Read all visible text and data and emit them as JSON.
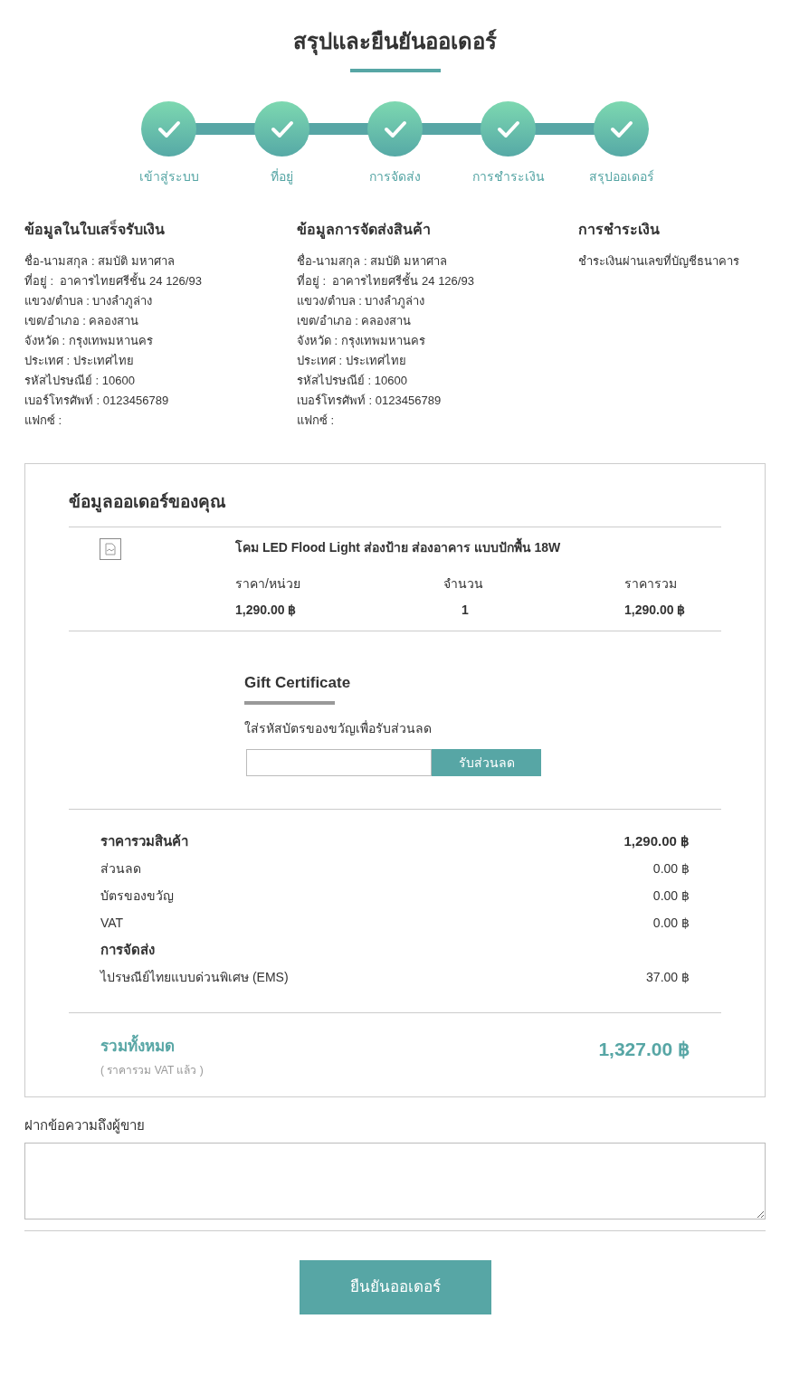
{
  "title": "สรุปและยืนยันออเดอร์",
  "steps": [
    {
      "label": "เข้าสู่ระบบ",
      "done": true
    },
    {
      "label": "ที่อยู่",
      "done": true
    },
    {
      "label": "การจัดส่ง",
      "done": true
    },
    {
      "label": "การชำระเงิน",
      "done": true
    },
    {
      "label": "สรุปออเดอร์",
      "done": true
    }
  ],
  "info_columns": [
    {
      "heading": "ข้อมูลในใบเสร็จรับเงิน",
      "lines": [
        "ชื่อ-นามสกุล : สมบัติ มหาศาล",
        "ที่อยู่ :  อาคารไทยศรีชั้น 24 126/93",
        "แขวง/ตำบล : บางลำภูล่าง",
        "เขต/อำเภอ : คลองสาน",
        "จังหวัด : กรุงเทพมหานคร",
        "ประเทศ : ประเทศไทย",
        "รหัสไปรษณีย์ : 10600",
        "เบอร์โทรศัพท์ : 0123456789",
        "แฟกซ์ :"
      ]
    },
    {
      "heading": "ข้อมูลการจัดส่งสินค้า",
      "lines": [
        "ชื่อ-นามสกุล : สมบัติ มหาศาล",
        "ที่อยู่ :  อาคารไทยศรีชั้น 24 126/93",
        "แขวง/ตำบล : บางลำภูล่าง",
        "เขต/อำเภอ : คลองสาน",
        "จังหวัด : กรุงเทพมหานคร",
        "ประเทศ : ประเทศไทย",
        "รหัสไปรษณีย์ : 10600",
        "เบอร์โทรศัพท์ : 0123456789",
        "แฟกซ์ :"
      ]
    },
    {
      "heading": "การชำระเงิน",
      "lines": [
        "ชำระเงินผ่านเลขที่บัญชีธนาคาร"
      ]
    }
  ],
  "order": {
    "heading": "ข้อมูลออเดอร์ของคุณ",
    "item": {
      "name": "โคม LED Flood Light ส่องป้าย ส่องอาคาร แบบปักพื้น 18W",
      "unit_price_label": "ราคา/หน่วย",
      "quantity_label": "จำนวน",
      "total_label": "ราคารวม",
      "unit_price": "1,290.00 ฿",
      "quantity": "1",
      "total": "1,290.00 ฿"
    },
    "gift": {
      "heading": "Gift Certificate",
      "hint": "ใส่รหัสบัตรของขวัญเพื่อรับส่วนลด",
      "button": "รับส่วนลด"
    },
    "summary": [
      {
        "kind": "bold",
        "label": "ราคารวมสินค้า",
        "value": "1,290.00 ฿"
      },
      {
        "kind": "normal",
        "label": "ส่วนลด",
        "value": "0.00 ฿"
      },
      {
        "kind": "normal",
        "label": "บัตรของขวัญ",
        "value": "0.00 ฿"
      },
      {
        "kind": "normal",
        "label": "VAT",
        "value": "0.00 ฿"
      },
      {
        "kind": "bold",
        "label": "การจัดส่ง"
      },
      {
        "kind": "normal",
        "label": "ไปรษณีย์ไทยแบบด่วนพิเศษ (EMS)",
        "value": "37.00 ฿"
      }
    ],
    "grand_total": {
      "label": "รวมทั้งหมด",
      "note": "( ราคารวม VAT แล้ว )",
      "value": "1,327.00 ฿"
    }
  },
  "message": {
    "label": "ฝากข้อความถึงผู้ขาย"
  },
  "confirm_button": "ยืนยันออเดอร์"
}
